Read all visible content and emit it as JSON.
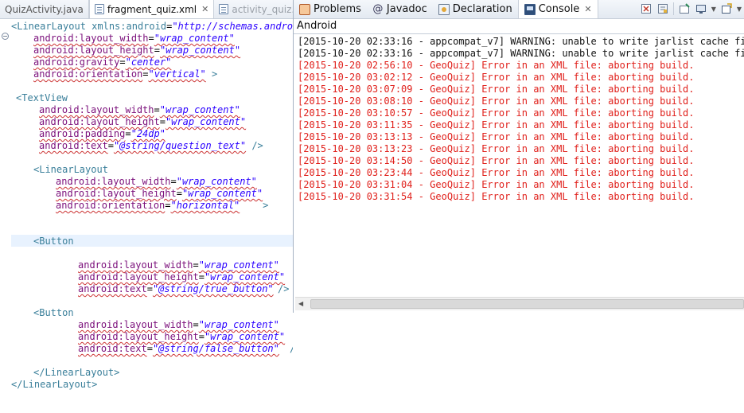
{
  "editor_tabs": [
    {
      "label": "QuizActivity.java",
      "active": false
    },
    {
      "label": "fragment_quiz.xml",
      "active": true
    },
    {
      "label": "activity_quiz.",
      "active": false
    }
  ],
  "view_tabs": [
    {
      "label": "Problems",
      "icon": "problems-icon"
    },
    {
      "label": "Javadoc",
      "icon": "javadoc-icon"
    },
    {
      "label": "Declaration",
      "icon": "declaration-icon"
    },
    {
      "label": "Console",
      "icon": "console-icon",
      "active": true
    }
  ],
  "console": {
    "label": "Android",
    "lines": [
      {
        "type": "warn",
        "text": "[2015-10-20 02:33:16 - appcompat_v7] WARNING: unable to write jarlist cache file"
      },
      {
        "type": "warn",
        "text": "[2015-10-20 02:33:16 - appcompat_v7] WARNING: unable to write jarlist cache file"
      },
      {
        "type": "error",
        "text": "[2015-10-20 02:56:10 - GeoQuiz] Error in an XML file: aborting build."
      },
      {
        "type": "error",
        "text": "[2015-10-20 03:02:12 - GeoQuiz] Error in an XML file: aborting build."
      },
      {
        "type": "error",
        "text": "[2015-10-20 03:07:09 - GeoQuiz] Error in an XML file: aborting build."
      },
      {
        "type": "error",
        "text": "[2015-10-20 03:08:10 - GeoQuiz] Error in an XML file: aborting build."
      },
      {
        "type": "error",
        "text": "[2015-10-20 03:10:57 - GeoQuiz] Error in an XML file: aborting build."
      },
      {
        "type": "error",
        "text": "[2015-10-20 03:11:35 - GeoQuiz] Error in an XML file: aborting build."
      },
      {
        "type": "error",
        "text": "[2015-10-20 03:13:13 - GeoQuiz] Error in an XML file: aborting build."
      },
      {
        "type": "error",
        "text": "[2015-10-20 03:13:23 - GeoQuiz] Error in an XML file: aborting build."
      },
      {
        "type": "error",
        "text": "[2015-10-20 03:14:50 - GeoQuiz] Error in an XML file: aborting build."
      },
      {
        "type": "error",
        "text": "[2015-10-20 03:23:44 - GeoQuiz] Error in an XML file: aborting build."
      },
      {
        "type": "error",
        "text": "[2015-10-20 03:31:04 - GeoQuiz] Error in an XML file: aborting build."
      },
      {
        "type": "error",
        "text": "[2015-10-20 03:31:54 - GeoQuiz] Error in an XML file: aborting build."
      }
    ]
  },
  "code": {
    "l1_tag": "<LinearLayout",
    "l1_ns_attr": " xmlns:android",
    "l1_ns_val": "\"http://schemas.android",
    "l2_attr": "android:layout_width",
    "l2_val": "\"wrap_content\"",
    "l3_attr": "android:layout_height",
    "l3_val": "\"wrap_content\"",
    "l4_attr": "android:gravity",
    "l4_val": "\"center\"",
    "l5_attr": "android:orientation",
    "l5_val": "\"vertical\"",
    "l5_end": " >",
    "tv_tag": "<TextView",
    "tv1_attr": "android:layout_width",
    "tv1_val": "\"wrap_content\"",
    "tv2_attr": "android:layout_height",
    "tv2_val": "\"wrap_content\"",
    "tv3_attr": "android:padding",
    "tv3_val": "\"24dp\"",
    "tv4_attr": "android:text",
    "tv4_val": "\"@string/question_text\"",
    "tv4_end": " />",
    "ll2_tag": "<LinearLayout",
    "ll2a_attr": "android:layout_width",
    "ll2a_val": "\"wrap_content\"",
    "ll2b_attr": "android:layout_height",
    "ll2b_val": "\"wrap_content\"",
    "ll2c_attr": "android:orientation",
    "ll2c_val": "\"horizontal\"",
    "ll2c_end": "    >",
    "b1_tag": "<Button",
    "b1a_attr": "android:layout_width",
    "b1a_val": "\"wrap_content\"",
    "b1b_attr": "android:layout_height",
    "b1b_val": "\"wrap_content\"",
    "b1c_attr": "android:text",
    "b1c_val": "\"@string/true_button\"",
    "b1_end": "/>",
    "b2_tag": "<Button",
    "b2a_attr": "android:layout_width",
    "b2a_val": "\"wrap_content\"",
    "b2b_attr": "android:layout_height",
    "b2b_val": "\"wrap_content\"",
    "b2c_attr": "android:text",
    "b2c_val": "\"@string/false_button\"",
    "b2_end": "/>",
    "close1": "</LinearLayout>",
    "close2": "</LinearLayout>",
    "eq": "="
  },
  "toolbar_icons": [
    "clear-console-icon",
    "scroll-lock-icon",
    "pin-console-icon",
    "display-console-icon",
    "open-console-icon"
  ]
}
